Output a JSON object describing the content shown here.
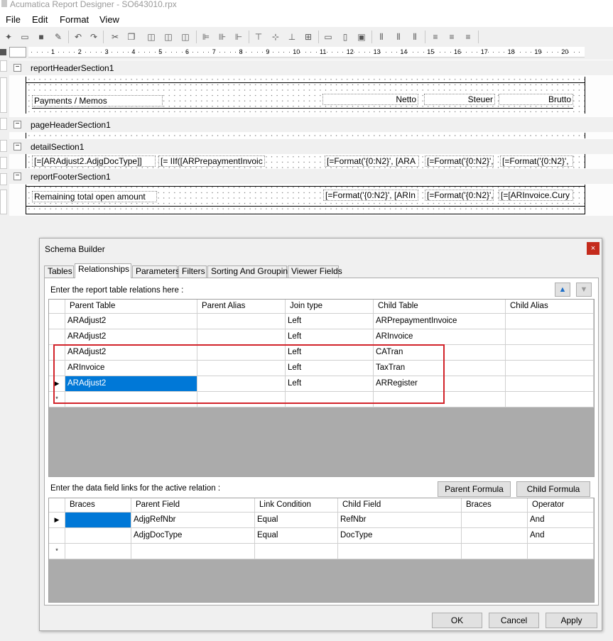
{
  "window": {
    "title": "Acumatica Report Designer - SO643010.rpx"
  },
  "menu": [
    "File",
    "Edit",
    "Format",
    "View"
  ],
  "toolbar": {
    "icons": [
      "new-report-icon",
      "open-icon",
      "save-icon",
      "properties-icon",
      "undo-icon",
      "redo-icon",
      "cut-icon",
      "copy-icon",
      "bring-to-front-icon",
      "send-to-back-icon",
      "group-icon",
      "align-left-icon",
      "align-center-icon",
      "align-right-icon",
      "align-top-icon",
      "align-middle-icon",
      "align-bottom-icon",
      "grid-icon",
      "same-width-icon",
      "same-height-icon",
      "same-size-icon",
      "hspace-equal-icon",
      "hspace-increase-icon",
      "hspace-decrease-icon",
      "vspace-equal-icon",
      "vspace-increase-icon",
      "vspace-decrease-icon"
    ]
  },
  "ruler": {
    "numbers": [
      "1",
      "2",
      "3",
      "4",
      "5",
      "6",
      "7",
      "8",
      "9",
      "10",
      "11",
      "12",
      "13",
      "14",
      "15",
      "16",
      "17",
      "18",
      "19",
      "20"
    ]
  },
  "report": {
    "sections": {
      "reportHeader": {
        "name": "reportHeaderSection1",
        "fields": {
          "payments": "Payments / Memos",
          "netto": "Netto",
          "steuer": "Steuer",
          "brutto": "Brutto"
        }
      },
      "pageHeader": {
        "name": "pageHeaderSection1"
      },
      "detail": {
        "name": "detailSection1",
        "fields": {
          "doctype": "[=[ARAdjust2.AdjgDocType]]",
          "iif": "[= IIf([ARPrepaymentInvoic",
          "fmt1": "[=Format('{0:N2}', [ARA",
          "fmt2": "[=Format('{0:N2}',",
          "fmt3": "[=Format('{0:N2}',"
        }
      },
      "reportFooter": {
        "name": "reportFooterSection1",
        "fields": {
          "remaining": "Remaining total open amount",
          "fmt1": "[=Format('{0:N2}', [ARIn",
          "fmt2": "[=Format('{0:N2}',",
          "cury": "[=[ARInvoice.Cury"
        }
      }
    }
  },
  "dialog": {
    "title": "Schema Builder",
    "close_glyph": "×",
    "tabs": [
      "Tables",
      "Relationships",
      "Parameters",
      "Filters",
      "Sorting And Grouping",
      "Viewer Fields"
    ],
    "active_tab": "Relationships",
    "relations_label": "Enter the report table relations here :",
    "relations": {
      "columns": [
        "Parent Table",
        "Parent Alias",
        "Join type",
        "Child Table",
        "Child Alias"
      ],
      "rows": [
        [
          "ARAdjust2",
          "",
          "Left",
          "ARPrepaymentInvoice",
          ""
        ],
        [
          "ARAdjust2",
          "",
          "Left",
          "ARInvoice",
          ""
        ],
        [
          "ARAdjust2",
          "",
          "Left",
          "CATran",
          ""
        ],
        [
          "ARInvoice",
          "",
          "Left",
          "TaxTran",
          ""
        ],
        [
          "ARAdjust2",
          "",
          "Left",
          "ARRegister",
          ""
        ]
      ],
      "current_row_index": 4,
      "new_row_marker": "*"
    },
    "links_label": "Enter the data field links for the active relation :",
    "parent_formula_label": "Parent Formula",
    "child_formula_label": "Child Formula",
    "links": {
      "columns": [
        "Braces",
        "Parent Field",
        "Link Condition",
        "Child Field",
        "Braces",
        "Operator"
      ],
      "rows": [
        [
          "",
          "AdjgRefNbr",
          "Equal",
          "RefNbr",
          "",
          "And"
        ],
        [
          "",
          "AdjgDocType",
          "Equal",
          "DocType",
          "",
          "And"
        ]
      ],
      "current_row_index": 0,
      "new_row_marker": "*"
    },
    "buttons": {
      "ok": "OK",
      "cancel": "Cancel",
      "apply": "Apply"
    }
  },
  "colors": {
    "selection": "#0078d7",
    "highlight_box": "#d2232a",
    "close_button": "#c42b1c"
  }
}
